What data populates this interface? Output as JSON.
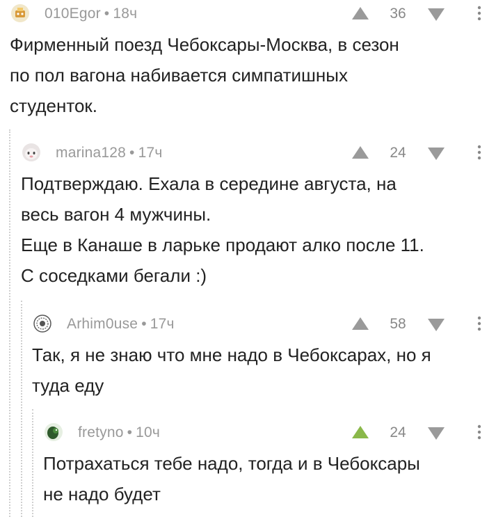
{
  "comments": [
    {
      "author": "010Egor",
      "time": "18ч",
      "score": "36",
      "text": "Фирменный поезд Чебоксары-Москва, в сезон\nпо пол вагона набивается симпатишных\nстуденток.",
      "upvoted": false
    },
    {
      "author": "marina128",
      "time": "17ч",
      "score": "24",
      "text": "Подтверждаю. Ехала в середине августа, на\nвесь вагон 4 мужчины.\nЕще в Канаше в ларьке продают алко после 11.\nС соседками бегали :)",
      "upvoted": false
    },
    {
      "author": "Arhim0use",
      "time": "17ч",
      "score": "58",
      "text": "Так, я не знаю что мне надо в Чебоксарах, но я\nтуда еду",
      "upvoted": false
    },
    {
      "author": "fretyno",
      "time": "10ч",
      "score": "24",
      "text": "Потрахаться тебе надо, тогда и в Чебоксары\nне надо будет",
      "upvoted": true
    }
  ],
  "meta_separator": "•",
  "colors": {
    "arrow_default": "#9a9a9a",
    "arrow_upvoted": "#8ab84a",
    "meta_text": "#999999",
    "body_text": "#222222",
    "thread_line": "#cfcfcf"
  },
  "icons": {
    "upvote": "triangle-up-icon",
    "downvote": "chevron-down-icon",
    "more": "vertical-dots-icon"
  }
}
